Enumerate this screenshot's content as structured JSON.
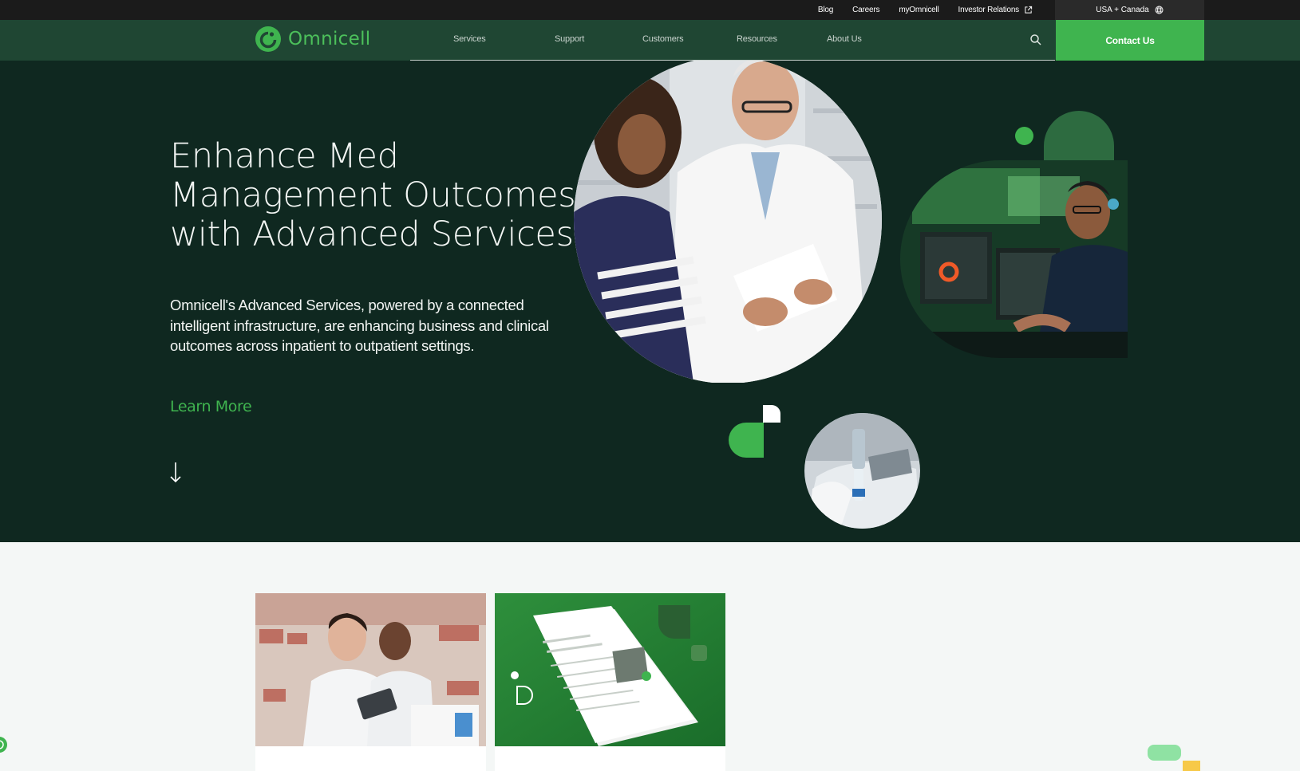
{
  "utility_bar": {
    "links": [
      "Blog",
      "Careers",
      "myOmnicell",
      "Investor Relations"
    ],
    "region_label": "USA + Canada"
  },
  "nav": {
    "logo_text": "Omnicell",
    "items": [
      "Services",
      "Support",
      "Customers",
      "Resources",
      "About Us"
    ],
    "contact_label": "Contact Us"
  },
  "hero": {
    "title": "Enhance Med Management Outcomes with Advanced Services",
    "body": "Omnicell's Advanced Services, powered by a connected intelligent infrastructure, are enhancing business and clinical outcomes across inpatient to outpatient settings.",
    "cta_label": "Learn More"
  },
  "icons": {
    "external": "external-link-icon",
    "globe": "globe-icon",
    "search": "search-icon",
    "scroll": "arrow-down-icon",
    "chat": "chat-icon"
  },
  "colors": {
    "nav_bg": "#1f4633",
    "hero_bg": "#0f2820",
    "brand_green": "#3fb44f"
  }
}
